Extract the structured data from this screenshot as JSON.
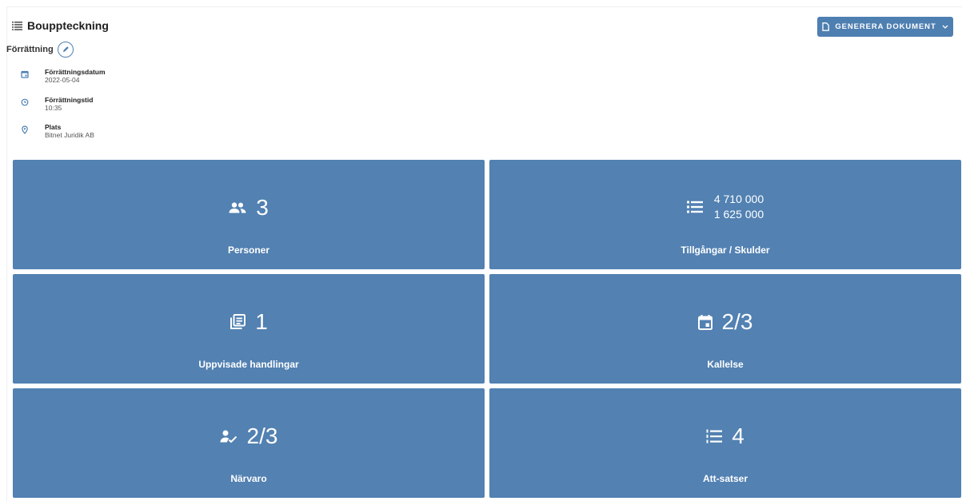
{
  "header": {
    "title": "Bouppteckning",
    "generate_button_label": "GENERERA DOKUMENT"
  },
  "section": {
    "label": "Förrättning",
    "items": [
      {
        "label": "Förrättningsdatum",
        "value": "2022-05-04",
        "icon": "calendar-icon"
      },
      {
        "label": "Förrättningstid",
        "value": "10:35",
        "icon": "clock-icon"
      },
      {
        "label": "Plats",
        "value": "Bitnet Juridik AB",
        "icon": "location-pin-icon"
      }
    ]
  },
  "tiles": [
    {
      "value": "3",
      "label": "Personer",
      "icon": "people-icon"
    },
    {
      "value_top": "4 710 000",
      "value_bottom": "1 625 000",
      "label": "Tillgångar / Skulder",
      "icon": "list-icon"
    },
    {
      "value": "1",
      "label": "Uppvisade handlingar",
      "icon": "documents-icon"
    },
    {
      "value": "2/3",
      "label": "Kallelse",
      "icon": "event-icon"
    },
    {
      "value": "2/3",
      "label": "Närvaro",
      "icon": "person-check-icon"
    },
    {
      "value": "4",
      "label": "Att-satser",
      "icon": "numbered-list-icon"
    }
  ],
  "colors": {
    "accent": "#4e7fb1",
    "tile_background": "#5281b2",
    "tile_text": "#ffffff"
  }
}
